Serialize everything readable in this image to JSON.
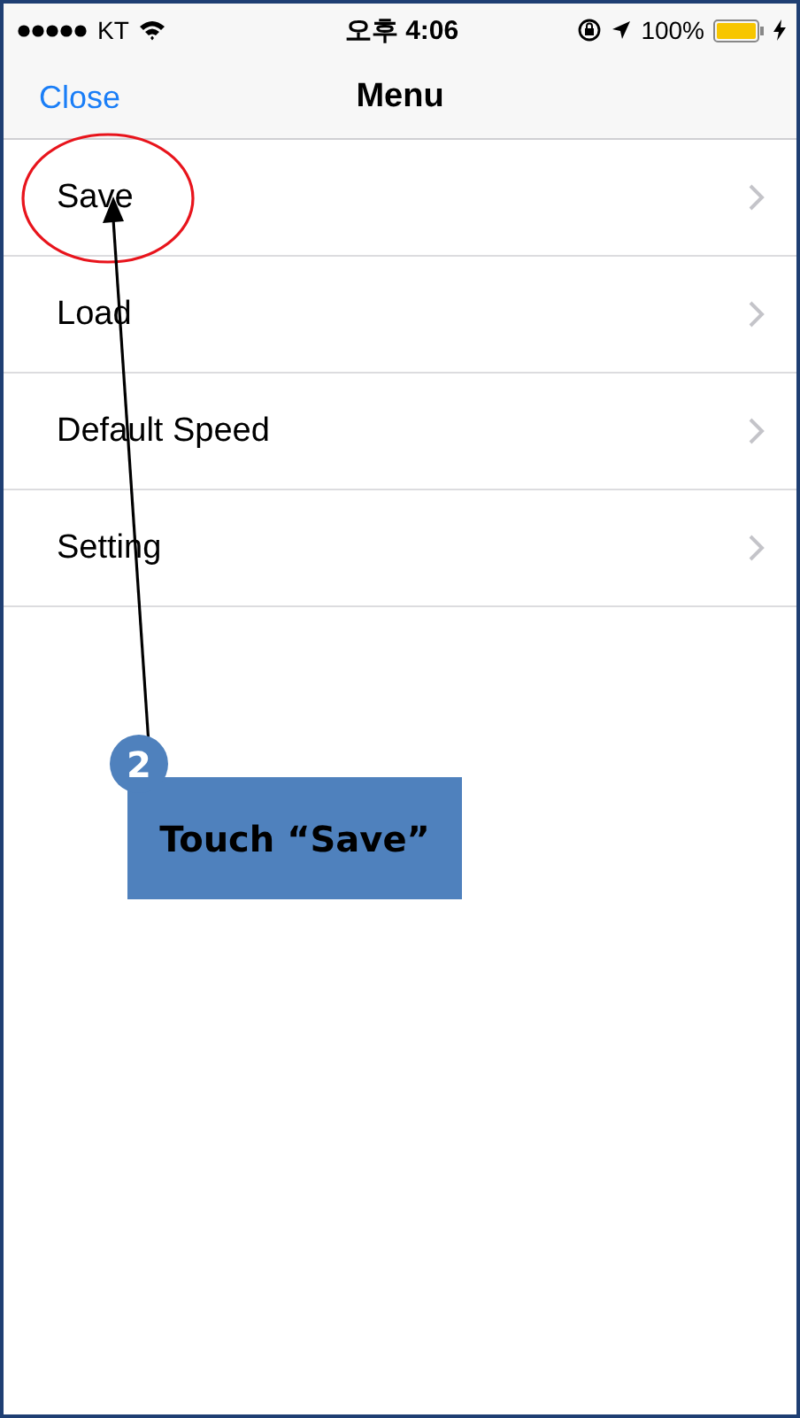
{
  "status_bar": {
    "carrier": "KT",
    "time": "오후 4:06",
    "battery": "100%"
  },
  "nav": {
    "left_button": "Close",
    "title": "Menu"
  },
  "menu_items": [
    {
      "label": "Save"
    },
    {
      "label": "Load"
    },
    {
      "label": "Default Speed"
    },
    {
      "label": "Setting"
    }
  ],
  "annotation": {
    "step": "2",
    "text": "Touch “Save”"
  }
}
